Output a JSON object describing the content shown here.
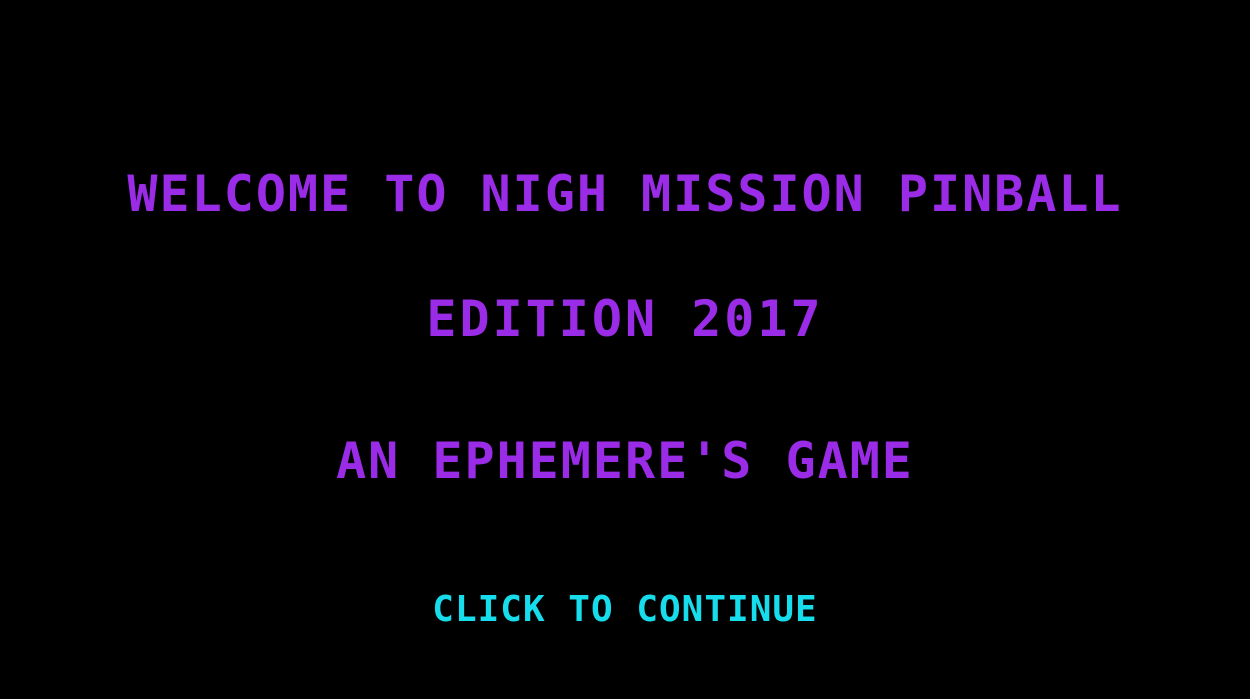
{
  "splash": {
    "title": "WELCOME TO NIGH MISSION PINBALL",
    "edition": "EDITION 2017",
    "credit": "AN EPHEMERE'S GAME",
    "continue_label": "CLICK TO CONTINUE"
  },
  "colors": {
    "background": "#000000",
    "title_text": "#9a2be6",
    "continue_text": "#16dceb"
  }
}
